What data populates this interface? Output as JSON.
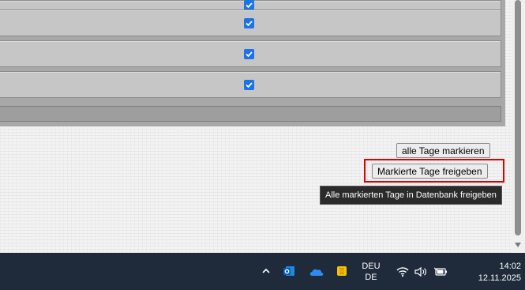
{
  "grid": {
    "rows": [
      {
        "checked": true
      },
      {
        "checked": true
      },
      {
        "checked": true
      }
    ]
  },
  "actions": {
    "mark_all_label": "alle Tage markieren",
    "release_label": "Markierte Tage freigeben",
    "tooltip": "Alle markierten Tage in Datenbank freigeben"
  },
  "taskbar": {
    "language_line1": "DEU",
    "language_line2": "DE",
    "time": "14:02",
    "date": "12.11.2025"
  },
  "colors": {
    "accent": "#1a73e8",
    "highlight": "#e00000",
    "taskbar": "#1f2a3a"
  }
}
